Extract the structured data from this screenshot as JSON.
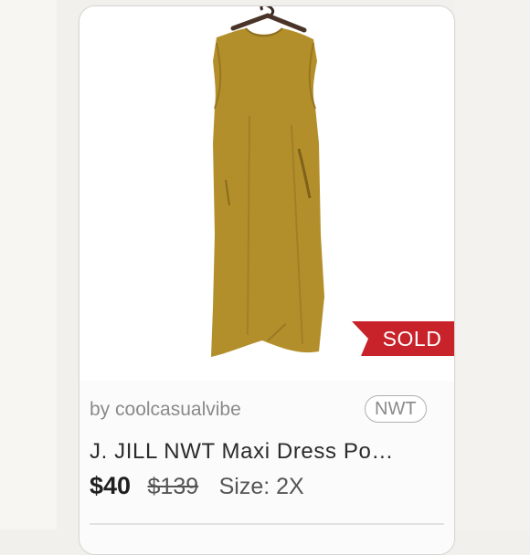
{
  "listing": {
    "seller": "by coolcasualvibe",
    "condition": "NWT",
    "title": "J. JILL NWT Maxi Dress Po…",
    "price": "$40",
    "original_price": "$139",
    "size": "Size: 2X",
    "status": "SOLD",
    "image_alt": "Mustard sleeveless maxi dress on hanger"
  },
  "colors": {
    "dress": "#b38f2c",
    "sold_red": "#c8222a",
    "card_border": "#d8d6d2"
  }
}
